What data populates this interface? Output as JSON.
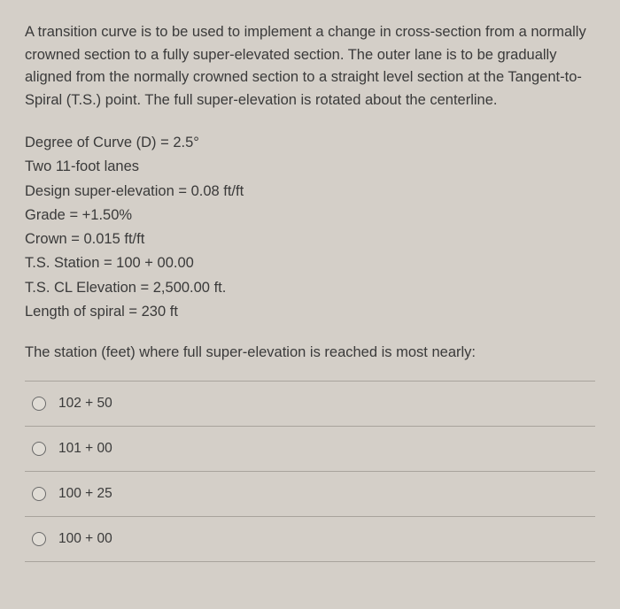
{
  "intro": "A transition curve is to be used to implement a change in cross-section from a normally crowned section to a fully super-elevated section. The outer lane is to be gradually aligned from the normally crowned section to a straight level section at the Tangent-to-Spiral (T.S.) point. The full super-elevation is rotated about the centerline.",
  "data_lines": {
    "l0": "Degree of Curve (D) = 2.5°",
    "l1": "Two 11-foot lanes",
    "l2": "Design super-elevation = 0.08 ft/ft",
    "l3": "Grade = +1.50%",
    "l4": "Crown = 0.015 ft/ft",
    "l5": "T.S. Station = 100 + 00.00",
    "l6": "T.S. CL Elevation = 2,500.00 ft.",
    "l7": "Length of spiral = 230 ft"
  },
  "question": "The station (feet) where full super-elevation is reached is most nearly:",
  "options": {
    "o0": "102 + 50",
    "o1": "101 + 00",
    "o2": "100 + 25",
    "o3": "100 + 00"
  }
}
